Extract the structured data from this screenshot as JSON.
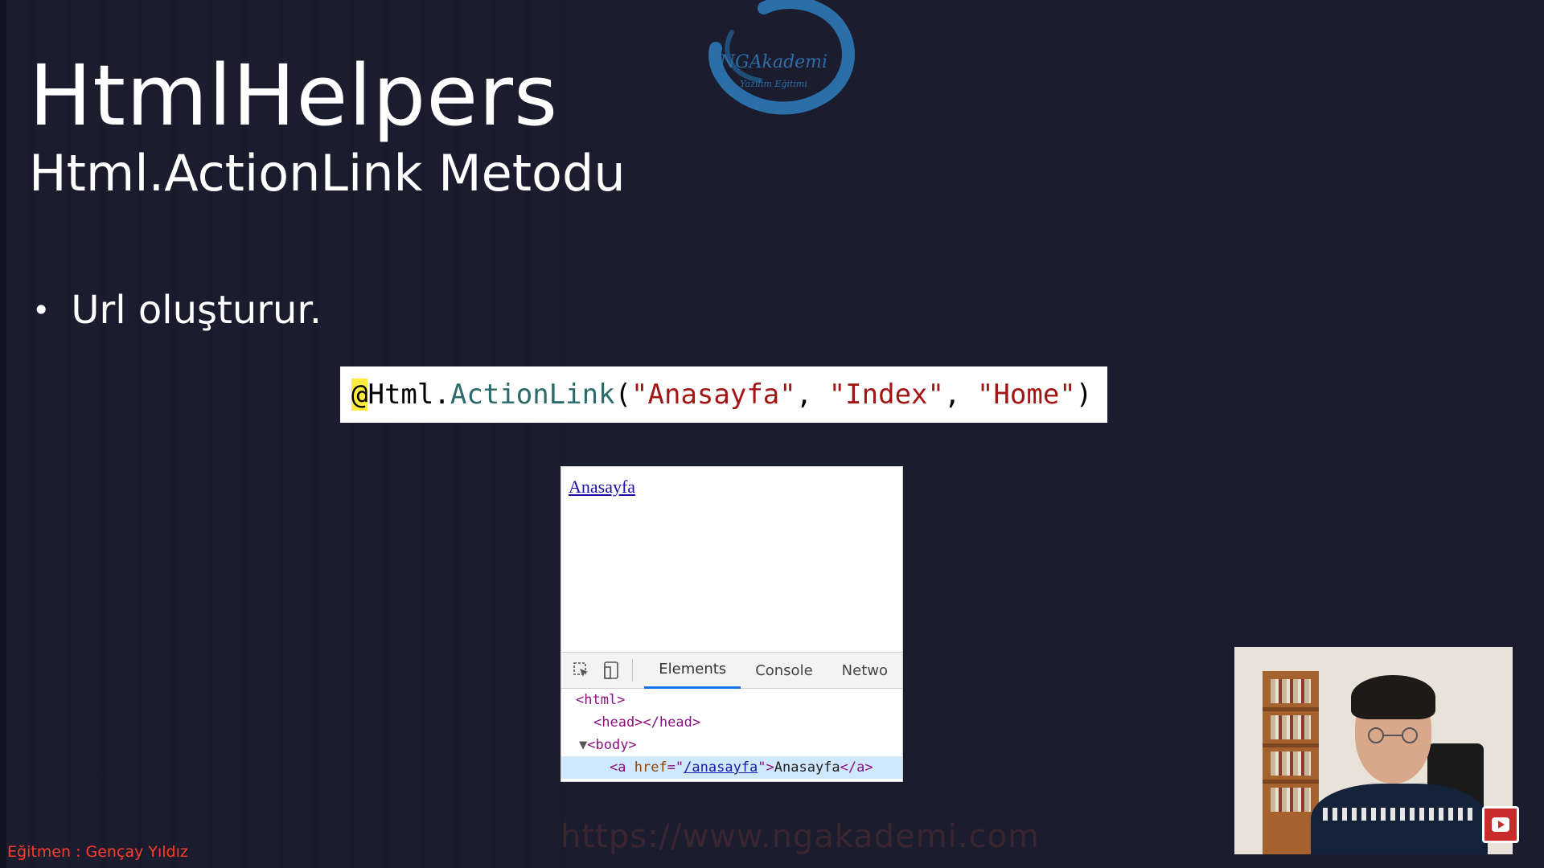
{
  "slide": {
    "title": "HtmlHelpers",
    "subtitle": "Html.ActionLink Metodu",
    "bullets": [
      "Url oluşturur."
    ]
  },
  "logo": {
    "main": "NGAkademi",
    "tagline": "Yazılım Eğitimi"
  },
  "code": {
    "at": "@",
    "obj": "Html",
    "dot": ".",
    "method": "ActionLink",
    "open": "(",
    "arg1": "\"Anasayfa\"",
    "sep1": ", ",
    "arg2": "\"Index\"",
    "sep2": ", ",
    "arg3": "\"Home\"",
    "close": ")"
  },
  "browser": {
    "link_text": "Anasayfa",
    "devtools": {
      "tabs": [
        "Elements",
        "Console",
        "Netwo"
      ],
      "active_tab": "Elements",
      "tree": {
        "html": "<html>",
        "head": "<head></head>",
        "body": "<body>",
        "anchor_open": "<a ",
        "anchor_attr": "href",
        "anchor_eq": "=\"",
        "anchor_href": "/anasayfa",
        "anchor_quote_close": "\">",
        "anchor_text": "Anasayfa",
        "anchor_close": "</a>"
      }
    }
  },
  "footer": {
    "watermark": "https://www.ngakademi.com",
    "instructor": "Eğitmen : Gençay Yıldız"
  },
  "colors": {
    "background": "#1b1c2e",
    "string": "#a31515",
    "method": "#2b6a6a",
    "highlight": "#ffec3d",
    "instructor": "#ff3b2b",
    "link": "#1a0dab"
  },
  "icons": [
    "inspect-element-icon",
    "device-toggle-icon",
    "expand-triangle-icon",
    "youtube-play-icon",
    "logo-ring-icon",
    "crescent-decoration-icon"
  ]
}
